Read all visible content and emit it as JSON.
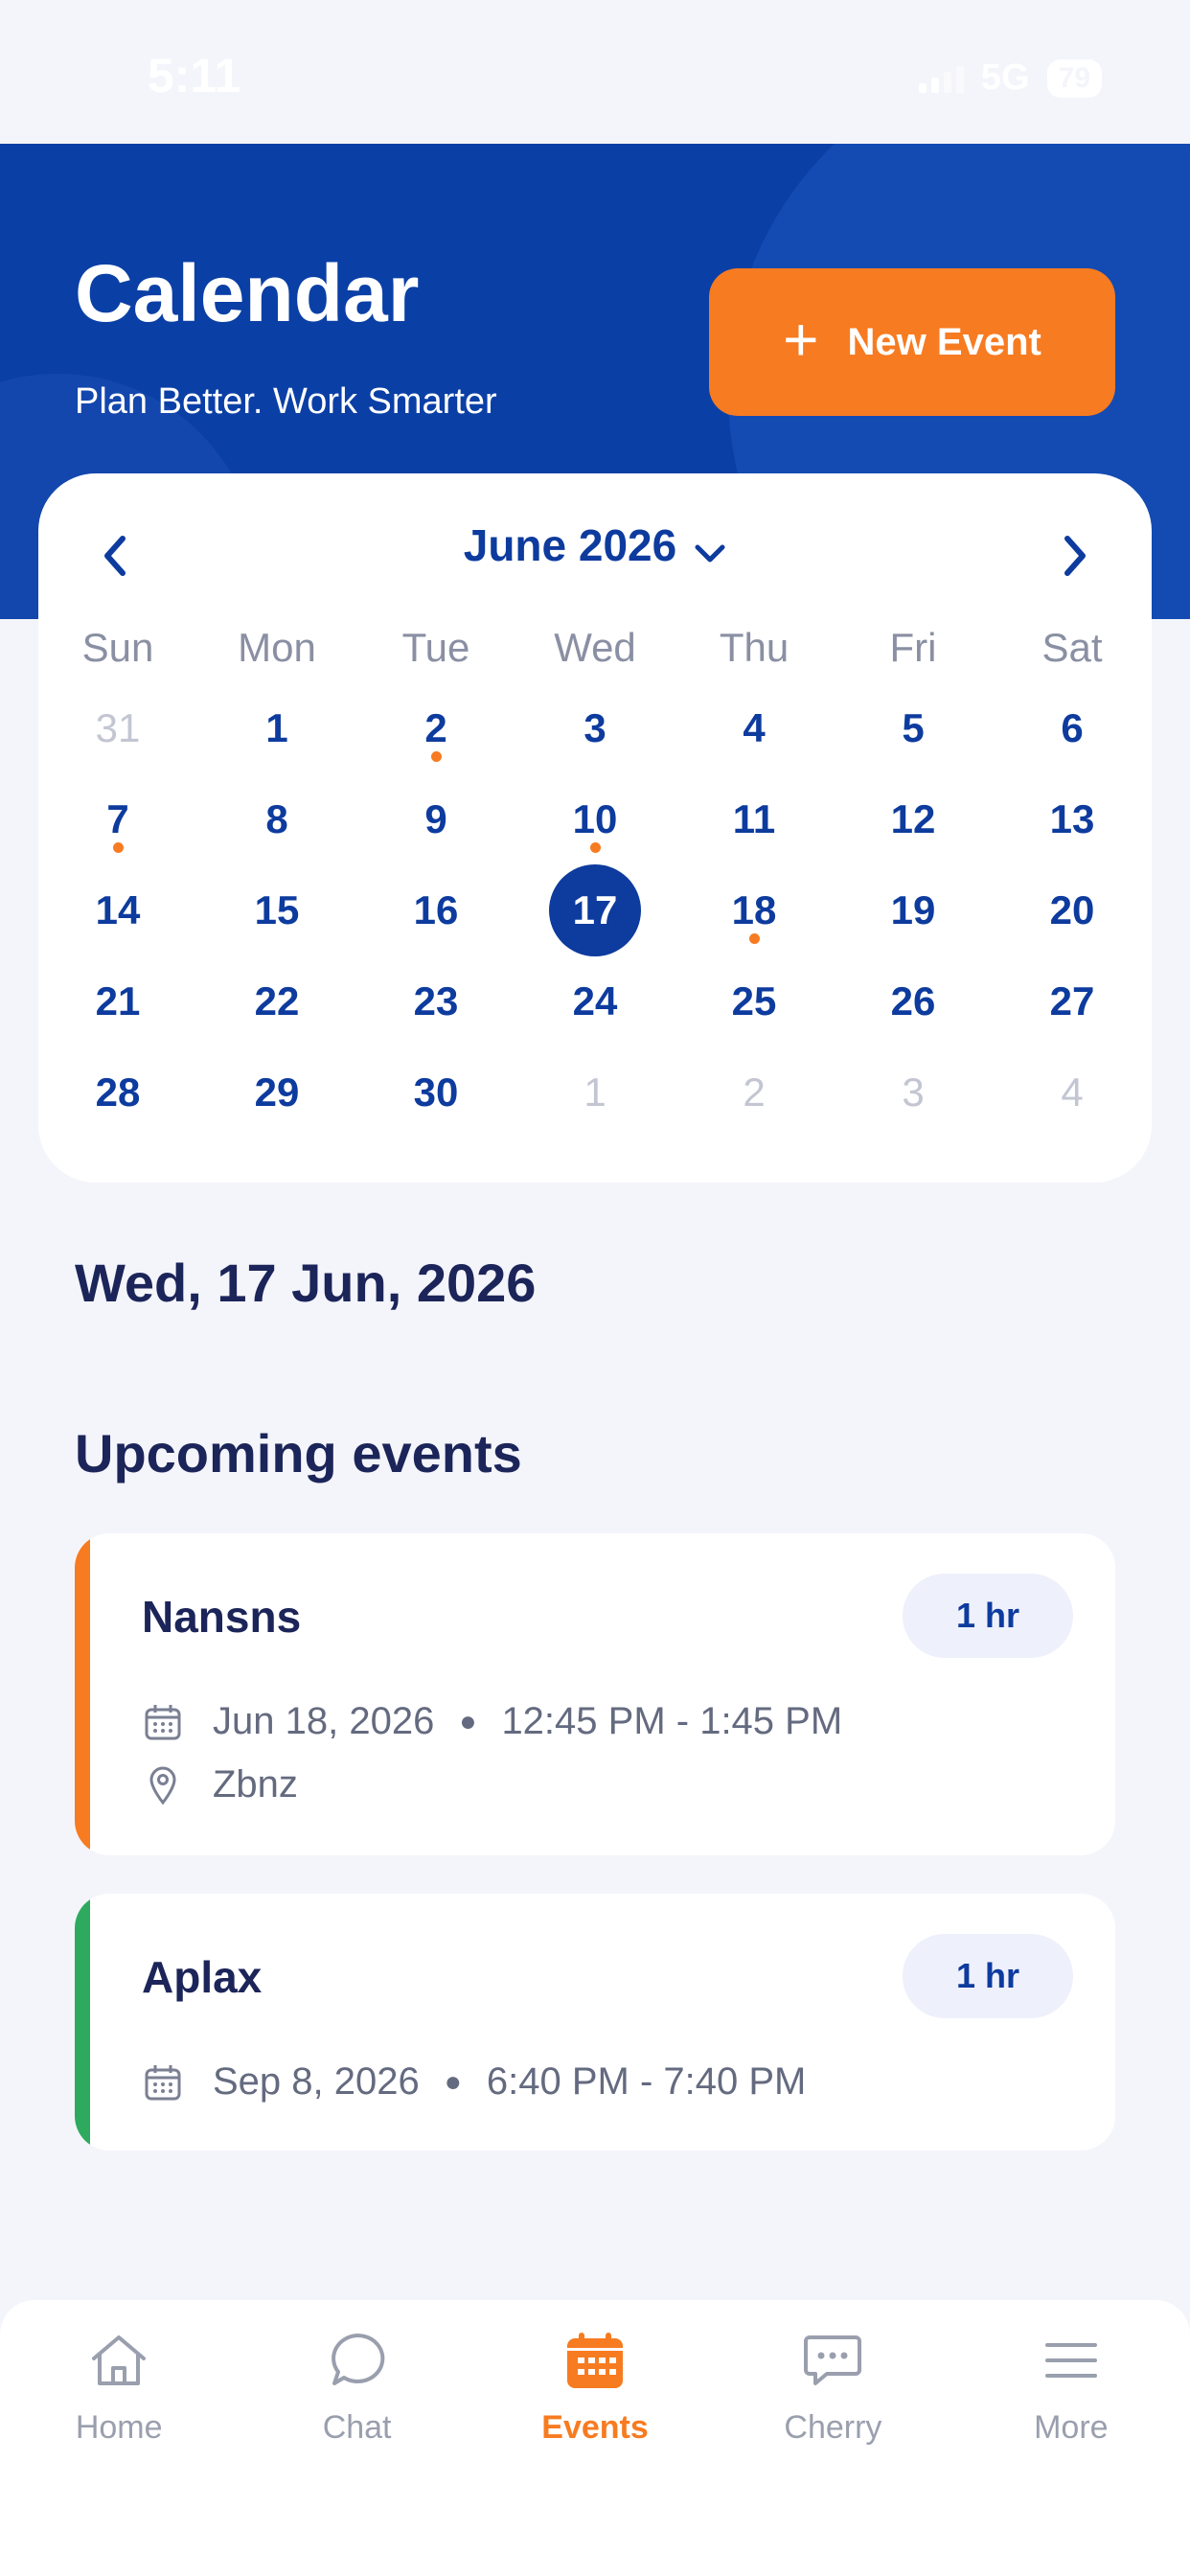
{
  "status_bar": {
    "time": "5:11",
    "network": "5G",
    "battery": "79"
  },
  "header": {
    "title": "Calendar",
    "subtitle": "Plan Better. Work Smarter",
    "new_event_label": "New Event"
  },
  "calendar": {
    "month_label": "June 2026",
    "weekdays": [
      "Sun",
      "Mon",
      "Tue",
      "Wed",
      "Thu",
      "Fri",
      "Sat"
    ],
    "weeks": [
      [
        "31",
        "1",
        "2",
        "3",
        "4",
        "5",
        "6"
      ],
      [
        "7",
        "8",
        "9",
        "10",
        "11",
        "12",
        "13"
      ],
      [
        "14",
        "15",
        "16",
        "17",
        "18",
        "19",
        "20"
      ],
      [
        "21",
        "22",
        "23",
        "24",
        "25",
        "26",
        "27"
      ],
      [
        "28",
        "29",
        "30",
        "1",
        "2",
        "3",
        "4"
      ]
    ],
    "selected_day": "17",
    "event_days": [
      "2",
      "7",
      "10",
      "18"
    ]
  },
  "selected_date_label": "Wed, 17 Jun, 2026",
  "upcoming_heading": "Upcoming events",
  "events": [
    {
      "title": "Nansns",
      "duration": "1 hr",
      "date": "Jun 18, 2026",
      "time": "12:45 PM - 1:45 PM",
      "location": "Zbnz",
      "color": "#f77b21"
    },
    {
      "title": "Aplax",
      "duration": "1 hr",
      "date": "Sep 8, 2026",
      "time": "6:40 PM - 7:40 PM",
      "color": "#2eaa5e"
    }
  ],
  "bottom_nav": [
    {
      "label": "Home",
      "icon": "home-icon"
    },
    {
      "label": "Chat",
      "icon": "chat-bubble-icon"
    },
    {
      "label": "Events",
      "icon": "calendar-icon",
      "active": true
    },
    {
      "label": "Cherry",
      "icon": "message-dots-icon"
    },
    {
      "label": "More",
      "icon": "menu-icon"
    }
  ],
  "colors": {
    "primary": "#0d3b9e",
    "accent": "#f77b21",
    "header_bg": "#0a3fa6"
  }
}
